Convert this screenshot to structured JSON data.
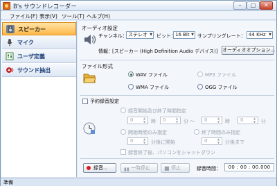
{
  "window": {
    "title": "B's サウンドレコーダー"
  },
  "menu": [
    "ファイル(F)",
    "表示(V)",
    "ツール(T)",
    "ヘルプ(H)"
  ],
  "sidebar": {
    "items": [
      {
        "label": "スピーカー",
        "icon": "speaker-icon",
        "active": true
      },
      {
        "label": "マイク",
        "icon": "microphone-icon",
        "active": false
      },
      {
        "label": "ユーザ定義",
        "icon": "user-settings-icon",
        "active": false
      },
      {
        "label": "サウンド抽出",
        "icon": "sound-extract-icon",
        "active": false
      }
    ]
  },
  "audio": {
    "section_title": "オーディオ設定",
    "channel_label": "チャンネル：",
    "channel_value": "ステレオ",
    "bit_label": "ビット：",
    "bit_value": "16 Bit",
    "rate_label": "サンプリングレート：",
    "rate_value": "44 KHz",
    "info_label": "情報：",
    "info_value": "[スピーカー (High Definition Audio デバイス)]",
    "options_button": "オーディオオプション..."
  },
  "format": {
    "section_title": "ファイル形式",
    "wav": "WAV ファイル",
    "mp3": "MP3 ファイル",
    "wma": "WMA ファイル",
    "ogg": "OGG ファイル",
    "selected": "WAV ファイル"
  },
  "schedule": {
    "checkbox_label": "予約録音設定",
    "start_end_label": "録音開始及び終了時間指定",
    "hour1": "0",
    "hour_unit": "時",
    "min1": "0",
    "min_unit_to": "分 ～",
    "hour2": "0",
    "min2": "0",
    "min_unit": "分",
    "start_only_label": "開始時間のみ指定",
    "end_only_label": "終了時間のみ指定",
    "start_min": "0",
    "start_min_suffix": "分後に開始",
    "end_min": "0",
    "end_min_suffix": "分後まで",
    "shutdown_label": "録音終了後、パソコンをシャットダウン"
  },
  "controls": {
    "record": "録音...",
    "pause": "一時停止",
    "stop": "停止",
    "time_label": "録音時間：",
    "time_value": "00 : 00 : 00.000"
  },
  "status": {
    "text": "準備"
  },
  "colors": {
    "active_tab": "#ffb848",
    "sidebar_text": "#1d3e78",
    "record_dot": "#e01818"
  }
}
